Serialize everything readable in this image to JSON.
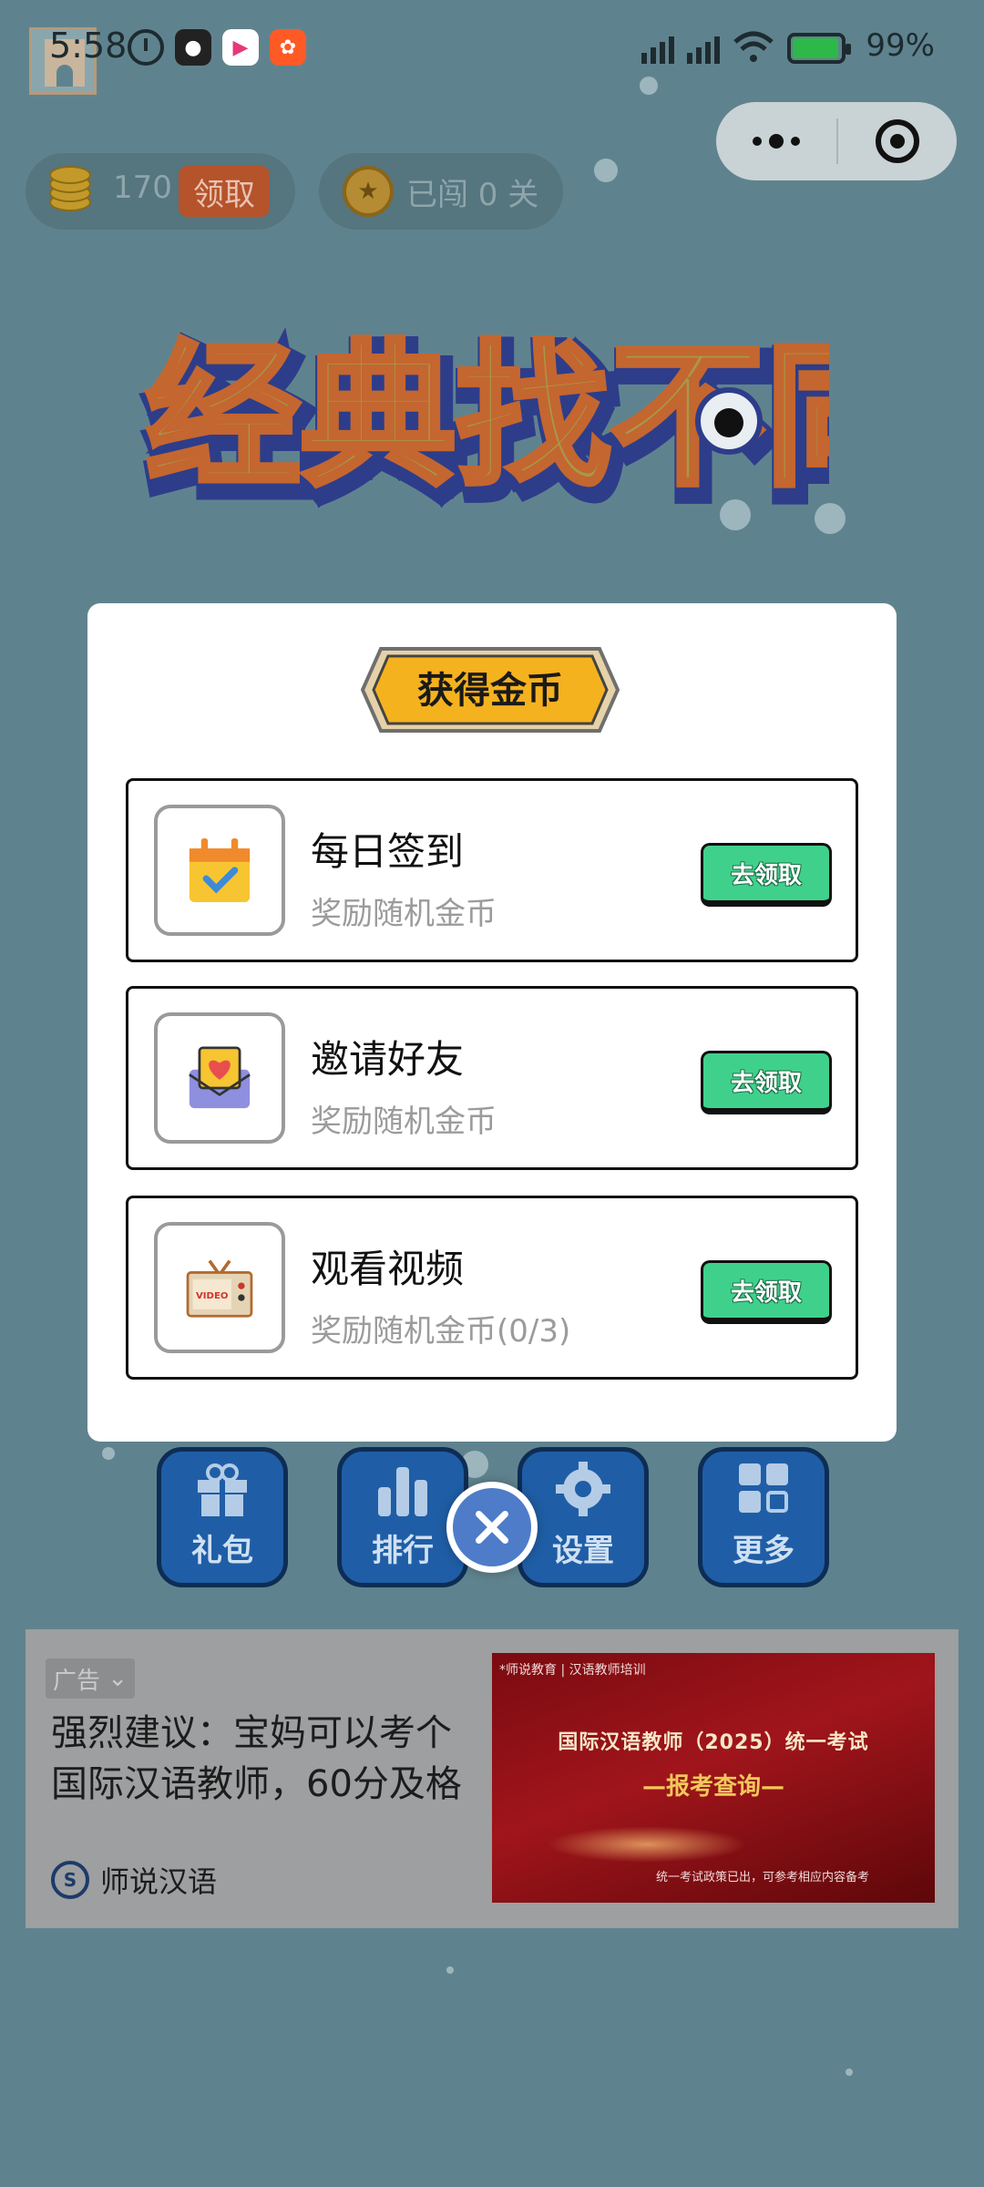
{
  "status_bar": {
    "time": "5:58",
    "battery": "99%"
  },
  "capsule": {
    "menu_icon": "more-dots-icon",
    "close_icon": "target-close-icon"
  },
  "header": {
    "coins": "170",
    "claim_label": "领取",
    "level_text": "已闯 0 关"
  },
  "game_title": "经典找不同",
  "modal": {
    "banner_title": "获得金币",
    "rows": [
      {
        "title": "每日签到",
        "subtitle": "奖励随机金币",
        "button": "去领取",
        "icon": "calendar-check-icon"
      },
      {
        "title": "邀请好友",
        "subtitle": "奖励随机金币",
        "button": "去领取",
        "icon": "envelope-heart-icon"
      },
      {
        "title": "观看视频",
        "subtitle": "奖励随机金币(0/3)",
        "button": "去领取",
        "icon": "tv-video-icon"
      }
    ]
  },
  "toolbar": [
    {
      "label": "礼包",
      "icon": "gift-icon"
    },
    {
      "label": "排行",
      "icon": "ranking-icon"
    },
    {
      "label": "设置",
      "icon": "gear-icon"
    },
    {
      "label": "更多",
      "icon": "grid-more-icon"
    }
  ],
  "ad": {
    "tag": "广告",
    "headline": "强烈建议：宝妈可以考个国际汉语教师，60分及格",
    "brand": "师说汉语",
    "image": {
      "top_text": "*师说教育 | 汉语教师培训",
      "headline": "国际汉语教师（2025）统一考试",
      "subheadline": "—报考查询—",
      "footer": "统一考试政策已出，可参考相应内容备考"
    }
  },
  "colors": {
    "background": "#5f838e",
    "claim_green": "#3fd18c",
    "tool_blue": "#1f5ea6",
    "banner_orange": "#f5b21f"
  }
}
